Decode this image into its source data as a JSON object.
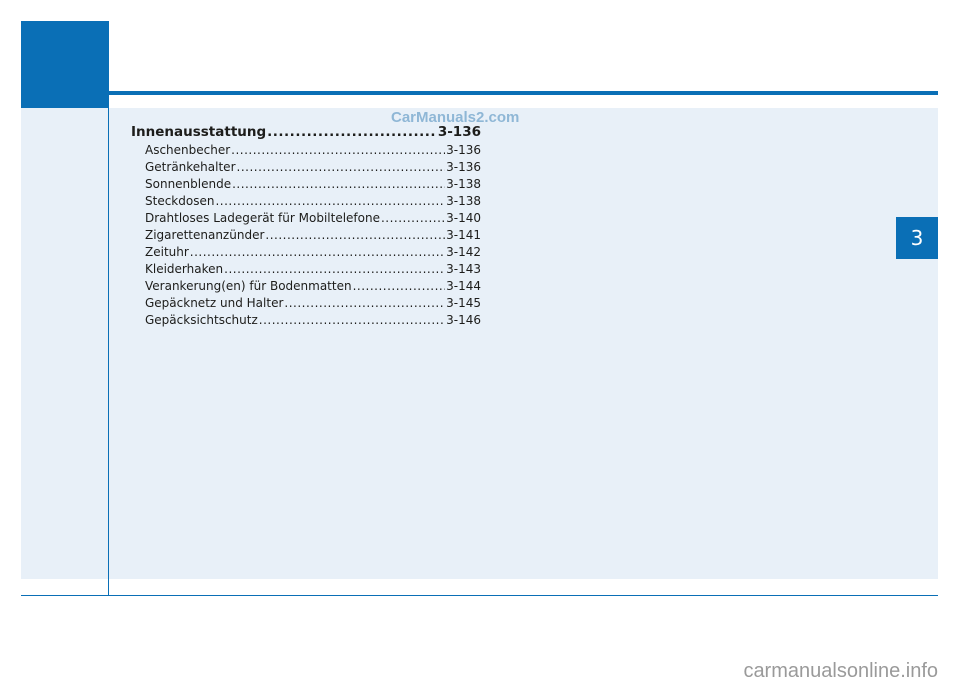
{
  "watermark": "CarManuals2.com",
  "chapter_tab": "3",
  "toc": {
    "section": {
      "title": "Innenausstattung",
      "page": "3-136"
    },
    "items": [
      {
        "title": "Aschenbecher",
        "page": "3-136"
      },
      {
        "title": "Getränkehalter",
        "page": "3-136"
      },
      {
        "title": "Sonnenblende",
        "page": "3-138"
      },
      {
        "title": "Steckdosen",
        "page": "3-138"
      },
      {
        "title": "Drahtloses Ladegerät für Mobiltelefone",
        "page": "3-140"
      },
      {
        "title": "Zigarettenanzünder",
        "page": "3-141"
      },
      {
        "title": "Zeituhr",
        "page": "3-142"
      },
      {
        "title": "Kleiderhaken",
        "page": "3-143"
      },
      {
        "title": "Verankerung(en) für Bodenmatten",
        "page": "3-144"
      },
      {
        "title": "Gepäcknetz und Halter",
        "page": "3-145"
      },
      {
        "title": "Gepäcksichtschutz",
        "page": "3-146"
      }
    ]
  },
  "footer_watermark": "carmanualsonline.info",
  "colors": {
    "accent": "#0a6fb6",
    "panel": "#e8f0f8"
  }
}
